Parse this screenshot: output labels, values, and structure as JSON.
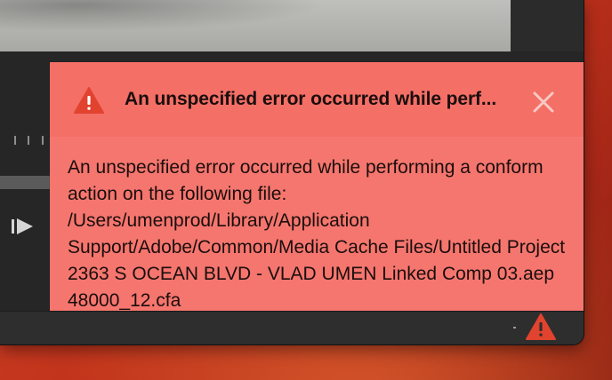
{
  "error": {
    "title": "An unspecified error occurred while perf...",
    "message": "An unspecified error occurred while performing a conform action on the following file: /Users/umenprod/Library/Application Support/Adobe/Common/Media Cache Files/Untitled Project 2363 S OCEAN BLVD - VLAD UMEN Linked Comp 03.aep 48000_12.cfa",
    "icon": "warning-icon",
    "close_icon": "close-icon"
  },
  "player": {
    "play_icon": "step-play-icon"
  },
  "status_bar": {
    "icon": "warning-icon"
  },
  "colors": {
    "error_panel": "#f5766e",
    "error_header": "#f46f66",
    "warning_icon": "#e1432f",
    "app_background": "#262626",
    "desktop": "#c2341c"
  }
}
